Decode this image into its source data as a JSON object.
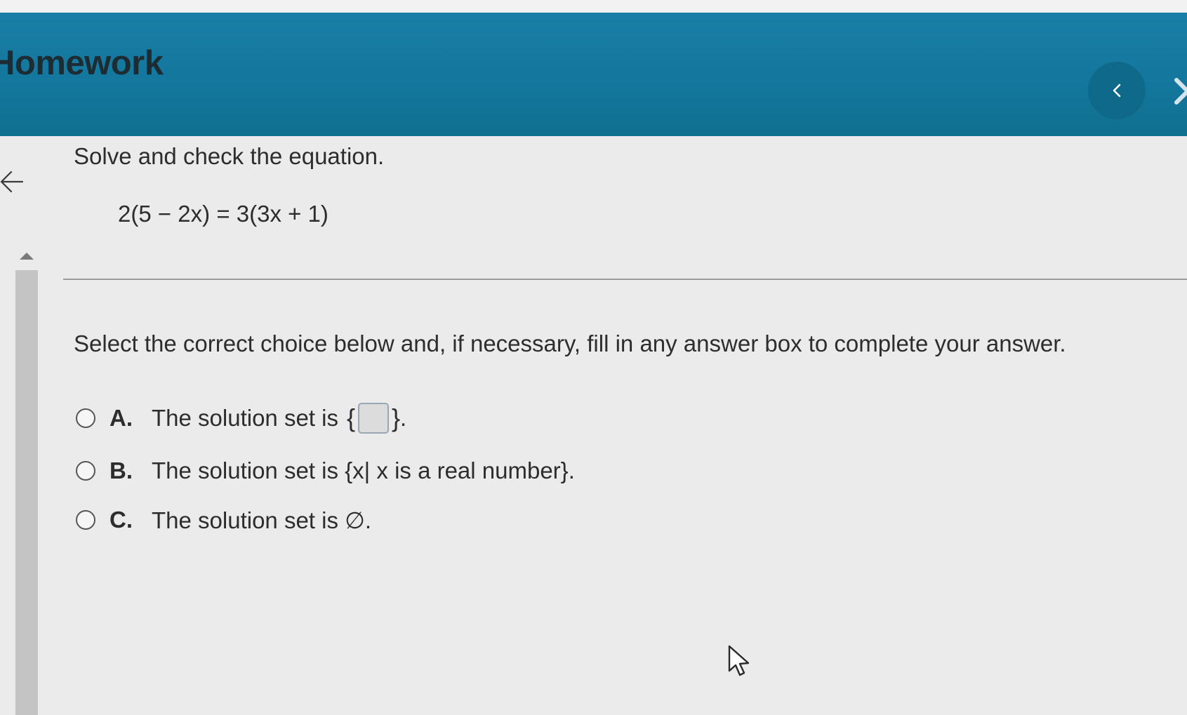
{
  "header": {
    "title": "Homework",
    "back_icon": "chevron-left-icon",
    "next_icon": "chevron-right-icon",
    "background_color": "#1479a0"
  },
  "question": {
    "instruction": "Solve and check the equation.",
    "equation": "2(5 − 2x) = 3(3x + 1)",
    "prompt": "Select the correct choice below and, if necessary, fill in any answer box to complete your answer."
  },
  "choices": [
    {
      "letter": "A.",
      "text": "The solution set is",
      "set_open": "{",
      "set_close": "}",
      "trailing": ".",
      "answer_value": ""
    },
    {
      "letter": "B.",
      "text": "The solution set is {x| x is a real number}."
    },
    {
      "letter": "C.",
      "text": "The solution set is ∅."
    }
  ],
  "icons": {
    "side_back": "arrow-left-icon",
    "scroll_up": "scroll-up-arrow-icon",
    "mouse_pointer": "mouse-pointer-icon"
  }
}
